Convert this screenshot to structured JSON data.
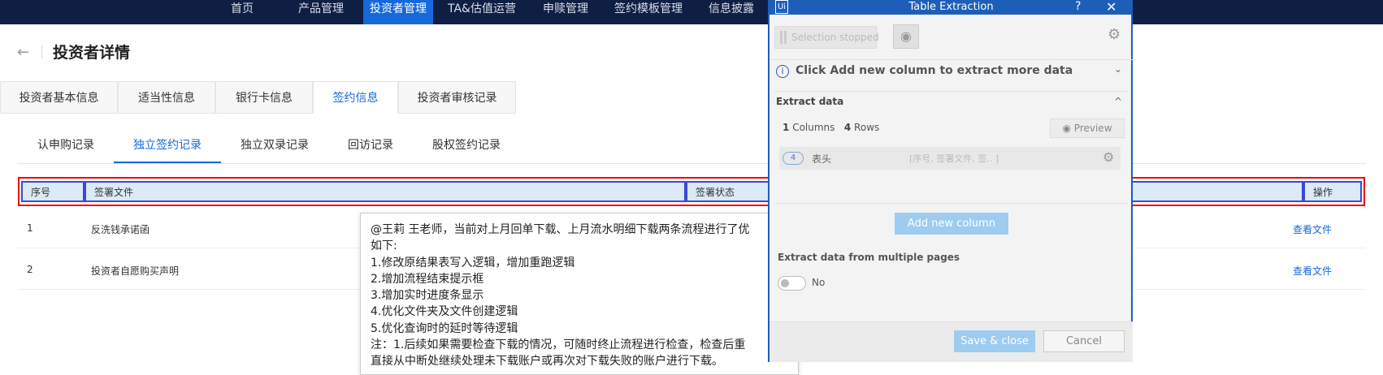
{
  "topnav": {
    "items": [
      "首页",
      "产品管理",
      "投资者管理",
      "TA&估值运营",
      "申赎管理",
      "签约模板管理",
      "信息披露"
    ],
    "active_index": 2
  },
  "page": {
    "back_icon": "←",
    "title": "投资者详情"
  },
  "tabs": [
    "投资者基本信息",
    "适当性信息",
    "银行卡信息",
    "签约信息",
    "投资者审核记录"
  ],
  "active_tab": 3,
  "subtabs": [
    "认申购记录",
    "独立签约记录",
    "独立双录记录",
    "回访记录",
    "股权签约记录"
  ],
  "active_subtab": 1,
  "table": {
    "headers": {
      "index": "序号",
      "file": "签署文件",
      "status": "签署状态",
      "action": "操作"
    },
    "rows": [
      {
        "index": "1",
        "file": "反洗钱承诺函",
        "action": "查看文件"
      },
      {
        "index": "2",
        "file": "投资者自愿购买声明",
        "action": "查看文件"
      }
    ]
  },
  "note": {
    "lines": [
      "@王莉 王老师，当前对上月回单下载、上月流水明细下载两条流程进行了优",
      "如下:",
      "1.修改原结果表写入逻辑，增加重跑逻辑",
      "2.增加流程结束提示框",
      "3.增加实时进度条显示",
      "4.优化文件夹及文件创建逻辑",
      "5.优化查询时的延时等待逻辑",
      "注：1.后续如果需要检查下载的情况，可随时终止流程进行检查，检查后重",
      "直接从中断处继续处理未下载账户或再次对下载失败的账户进行下载。"
    ]
  },
  "dialog": {
    "logo": "Ui",
    "title": "Table Extraction",
    "help": "?",
    "close": "✕",
    "selection_label": "Selection stopped",
    "eye_icon": "◉",
    "gear_icon": "⚙",
    "info_icon": "i",
    "info_text": "Click Add new column to extract more data",
    "chevron_down": "⌄",
    "chevron_up": "^",
    "extract_header": "Extract data",
    "columns_count": "1",
    "columns_label": "Columns",
    "rows_count": "4",
    "rows_label": "Rows",
    "preview_label": "Preview",
    "preview_icon": "◉",
    "column": {
      "badge": "4",
      "name": "表头",
      "preview": "[序号, 签署文件, 签..   ]"
    },
    "add_column_label": "Add new column",
    "multi_pages_label": "Extract data from multiple pages",
    "toggle_label": "No",
    "save_label": "Save & close",
    "cancel_label": "Cancel"
  },
  "colors": {
    "accent": "#1668dc",
    "nav_bg": "#0f1f44",
    "dialog_blue": "#1d5fb8",
    "highlight_red": "#ee0000"
  }
}
